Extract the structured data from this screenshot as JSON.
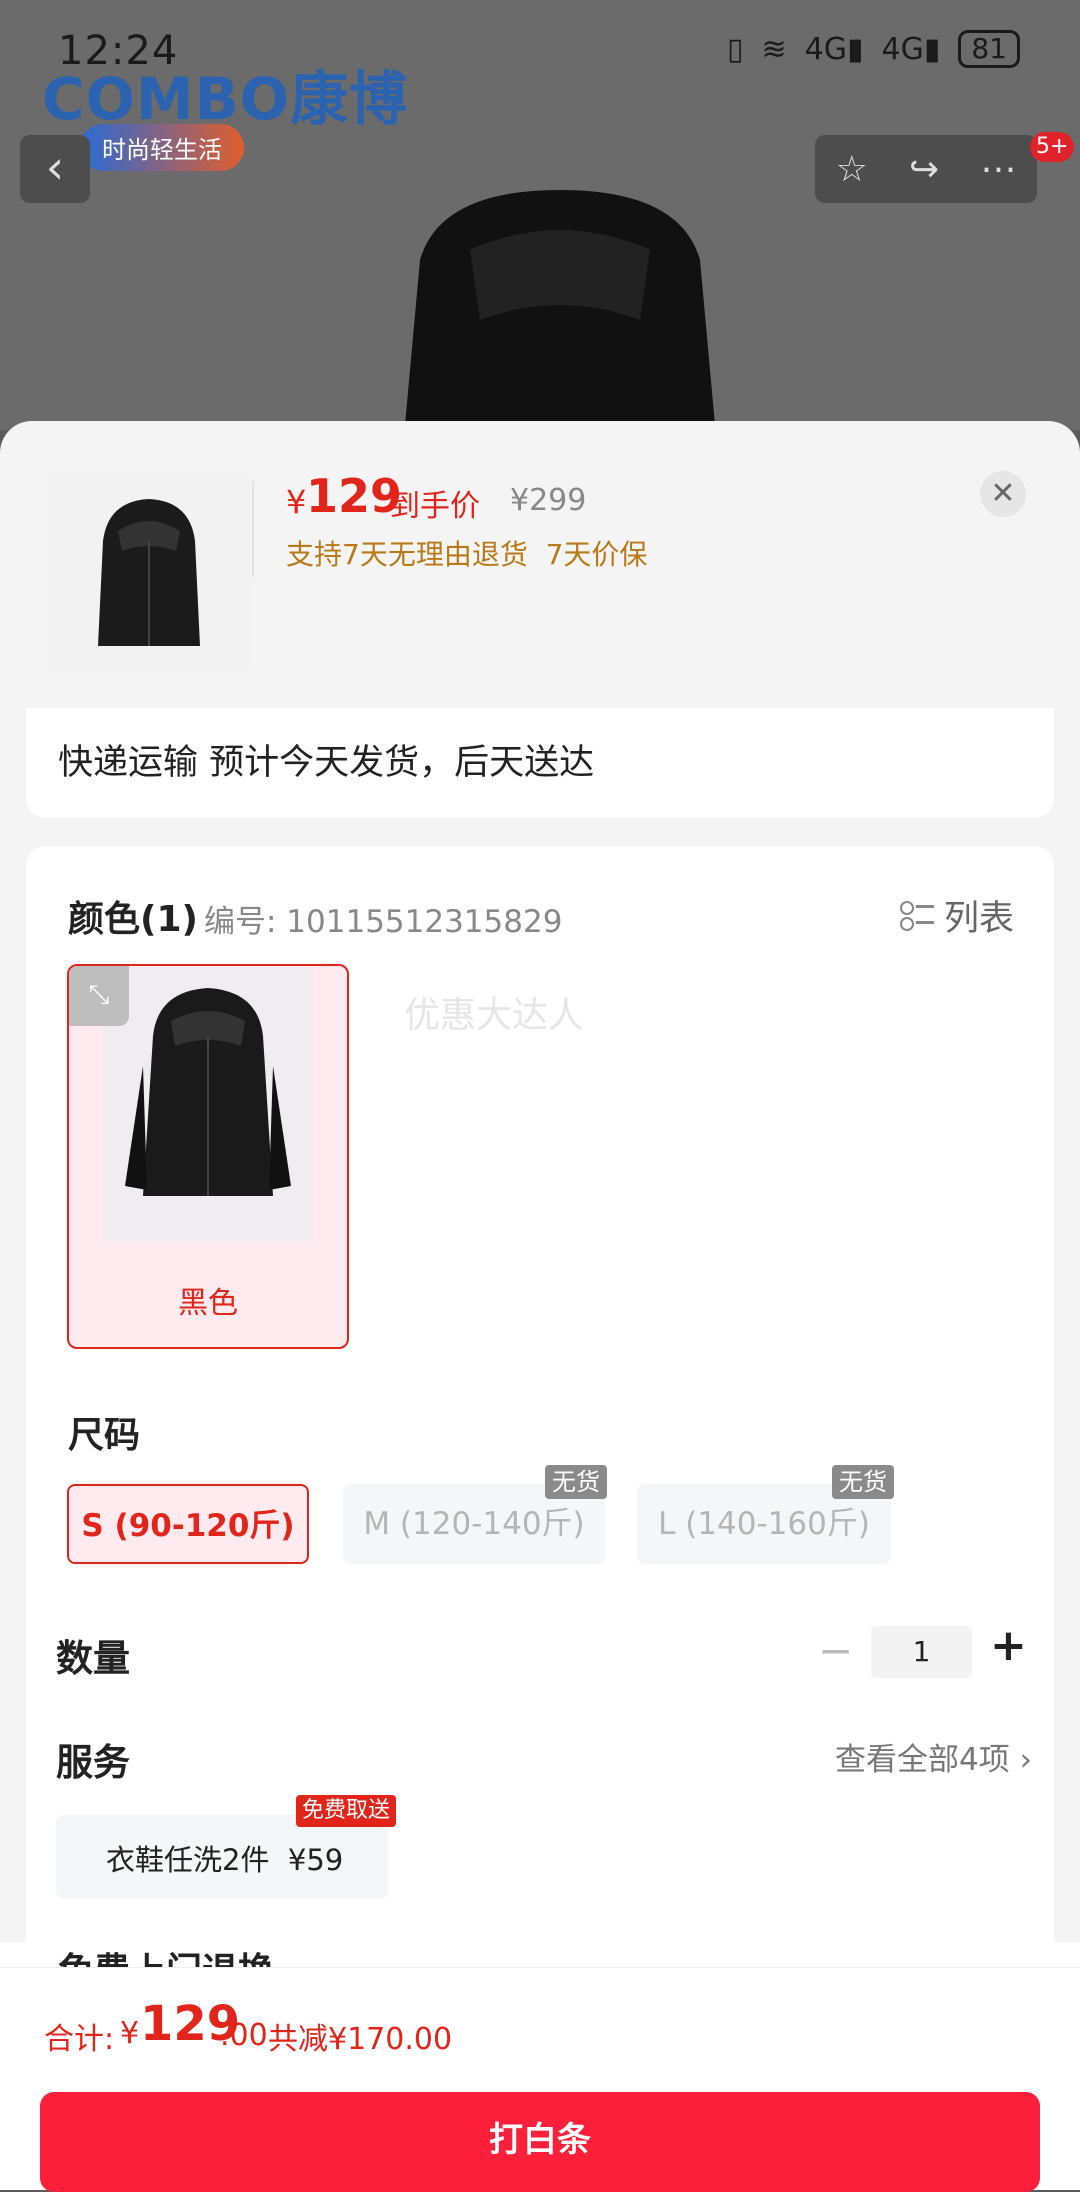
{
  "status_bar": {
    "time": "12:24",
    "battery": "81"
  },
  "background_page": {
    "brand_logo": "COMBO康博",
    "brand_tagline": "时尚轻生活",
    "notification_badge": "5+"
  },
  "sheet": {
    "price_symbol": "¥",
    "price": "129",
    "price_label": "到手价",
    "original_price": "¥299",
    "guarantee": "支持7天无理由退货  7天价保",
    "close_icon": "close-icon",
    "shipping": "快递运输 预计今天发货，后天送达",
    "color_title": "颜色(1)",
    "color_code": "编号: 10115512315829",
    "list_toggle": "列表",
    "color_options": [
      {
        "name": "黑色"
      }
    ],
    "watermark": "优惠大达人",
    "size_title": "尺码",
    "sizes": [
      {
        "label": "S (90-120斤)",
        "selected": true,
        "soldout": false
      },
      {
        "label": "M (120-140斤)",
        "selected": false,
        "soldout": true
      },
      {
        "label": "L (140-160斤)",
        "selected": false,
        "soldout": true
      }
    ],
    "soldout_label": "无货",
    "quantity_title": "数量",
    "quantity": "1",
    "service_title": "服务",
    "service_all": "查看全部4项",
    "service_item": "衣鞋任洗2件  ¥59",
    "service_badge": "免费取送",
    "partial_row_text": "免费上门退换"
  },
  "bottom_bar": {
    "total_label": "合计:",
    "total_symbol": "¥",
    "total_main": "129",
    "total_decimal": ".00",
    "total_discount": "共减¥170.00",
    "buy_button": "打白条"
  },
  "colors": {
    "accent": "#e1251b",
    "buy_button": "#fb1f3a",
    "guarantee": "#b87916"
  }
}
